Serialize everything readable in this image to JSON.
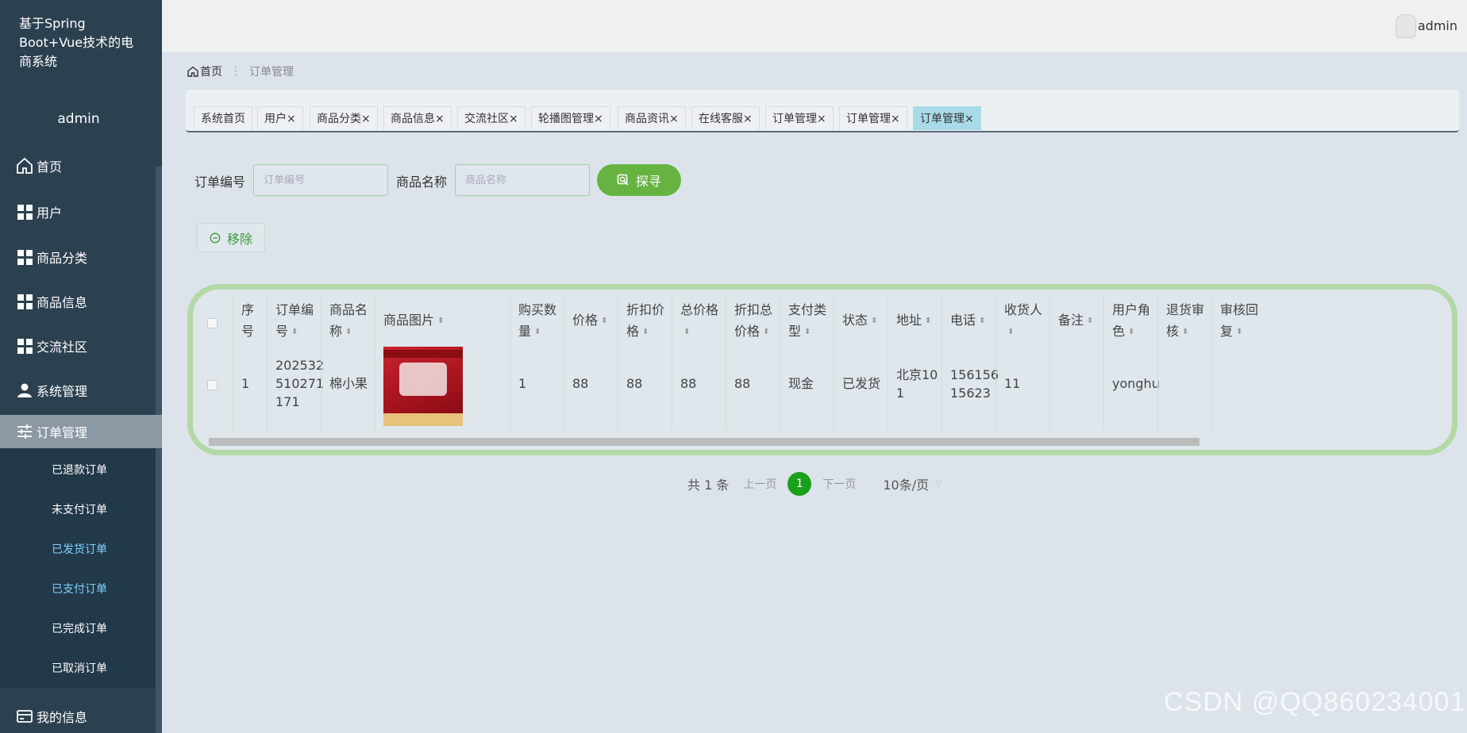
{
  "sidebar": {
    "app_title": "基于Spring Boot+Vue技术的电商系统",
    "user": "admin",
    "menu": [
      {
        "label": "首页",
        "icon": "home-icon"
      },
      {
        "label": "用户",
        "icon": "grid-icon"
      },
      {
        "label": "商品分类",
        "icon": "grid-icon"
      },
      {
        "label": "商品信息",
        "icon": "grid-icon"
      },
      {
        "label": "交流社区",
        "icon": "grid-icon"
      },
      {
        "label": "系统管理",
        "icon": "user-icon"
      },
      {
        "label": "订单管理",
        "icon": "sliders-icon"
      },
      {
        "label": "我的信息",
        "icon": "card-icon"
      }
    ],
    "submenu": [
      "已退款订单",
      "未支付订单",
      "已发货订单",
      "已支付订单",
      "已完成订单",
      "已取消订单"
    ]
  },
  "topbar": {
    "user": "admin"
  },
  "breadcrumb": {
    "home": "首页",
    "current": "订单管理"
  },
  "tabs": [
    "系统首页",
    "用户",
    "商品分类",
    "商品信息",
    "交流社区",
    "轮播图管理",
    "商品资讯",
    "在线客服",
    "订单管理",
    "订单管理",
    "订单管理"
  ],
  "tab_close": "×",
  "search": {
    "order_label": "订单编号",
    "order_placeholder": "订单编号",
    "product_label": "商品名称",
    "product_placeholder": "商品名称",
    "button": "探寻"
  },
  "actions": {
    "remove": "移除"
  },
  "table": {
    "headers": [
      "序号",
      "订单编号",
      "商品名称",
      "商品图片",
      "购买数量",
      "价格",
      "折扣价格",
      "总价格",
      "折扣总价格",
      "支付类型",
      "状态",
      "地址",
      "电话",
      "收货人",
      "备注",
      "用户角色",
      "退货审核",
      "审核回复"
    ],
    "header_lines": [
      [
        "序",
        "号"
      ],
      [
        "订单编",
        "号"
      ],
      [
        "商品名",
        "称"
      ],
      [
        "商品图片"
      ],
      [
        "购买数",
        "量"
      ],
      [
        "价格"
      ],
      [
        "折扣价",
        "格"
      ],
      [
        "总价格",
        ""
      ],
      [
        "折扣总",
        "价格"
      ],
      [
        "支付类",
        "型"
      ],
      [
        "状态"
      ],
      [
        "地址"
      ],
      [
        "电话"
      ],
      [
        "收货人",
        ""
      ],
      [
        "备注"
      ],
      [
        "用户角",
        "色"
      ],
      [
        "退货审",
        "核"
      ],
      [
        "审核回",
        "复"
      ]
    ],
    "rows": [
      {
        "cells": [
          "1",
          "202532510271171",
          "棉小果",
          "",
          "1",
          "88",
          "88",
          "88",
          "88",
          "现金",
          "已发货",
          "北京101",
          "15615615623",
          "11",
          "",
          "yonghu",
          "",
          ""
        ],
        "lines": [
          [
            "1"
          ],
          [
            "202532",
            "510271",
            "171"
          ],
          [
            "棉小果"
          ],
          [
            ""
          ],
          [
            "1"
          ],
          [
            "88"
          ],
          [
            "88"
          ],
          [
            "88"
          ],
          [
            "88"
          ],
          [
            "现金"
          ],
          [
            "已发货"
          ],
          [
            "北京10",
            "1"
          ],
          [
            "156156",
            "15623"
          ],
          [
            "11"
          ],
          [
            ""
          ],
          [
            "yonghu"
          ],
          [
            ""
          ],
          [
            ""
          ]
        ]
      }
    ]
  },
  "pagination": {
    "total": "共 1 条",
    "prev": "上一页",
    "current": "1",
    "next": "下一页",
    "page_size": "10条/页"
  },
  "watermark": "CSDN @QQ860234001",
  "colors": {
    "sidebar": "#2c4150",
    "accent_green": "#67b342",
    "table_border": "#b3d9a6",
    "active_tab": "#a8dbe8"
  }
}
